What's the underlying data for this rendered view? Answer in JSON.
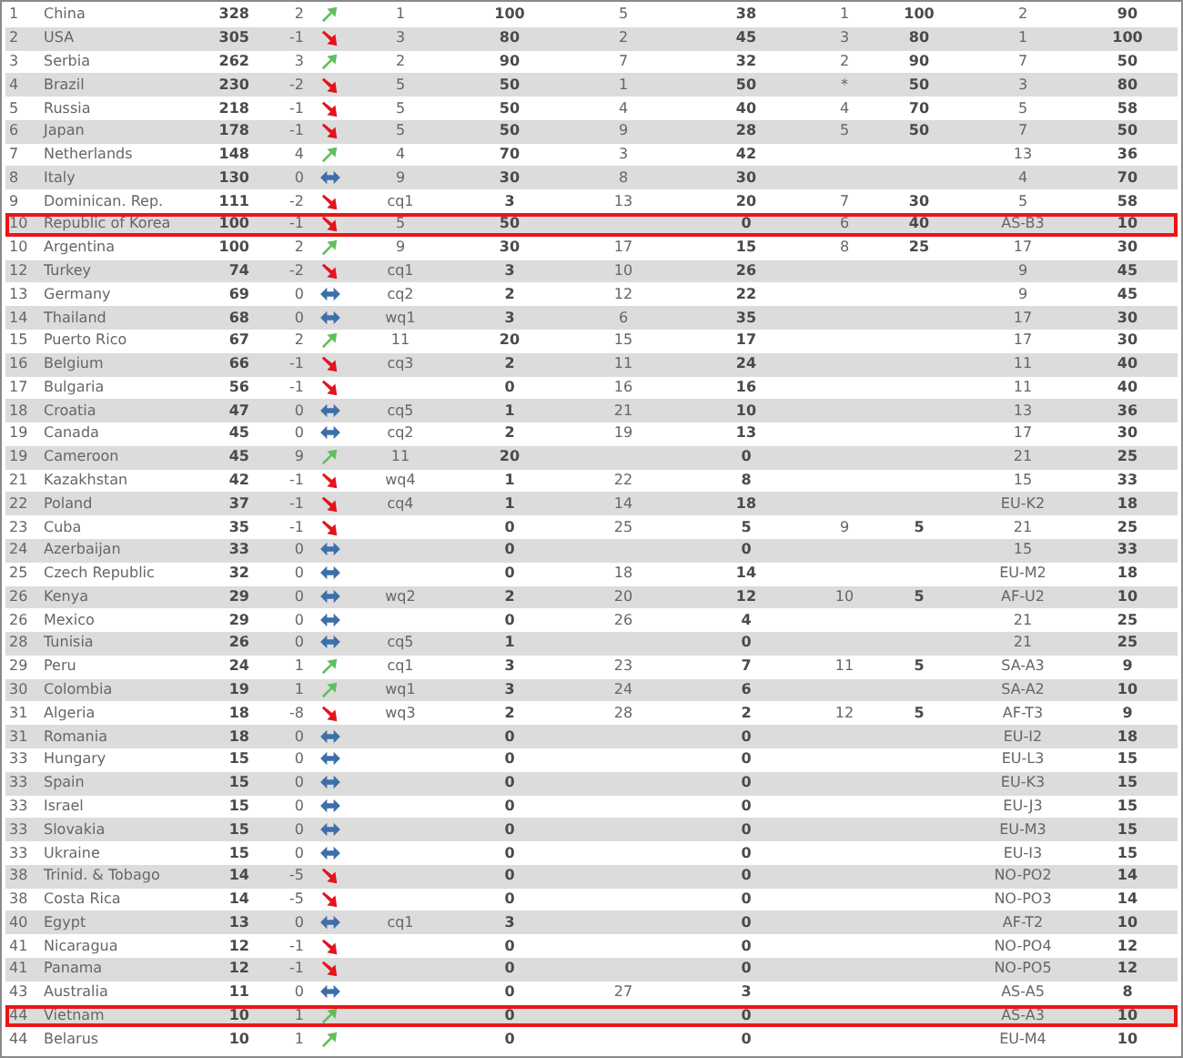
{
  "table": {
    "rows": [
      {
        "cells": [
          "1",
          "China",
          "328",
          "2",
          "1",
          "100",
          "5",
          "38",
          "1",
          "100",
          "2",
          "90"
        ],
        "trend": {
          "kind": "up"
        },
        "highlighted": false
      },
      {
        "cells": [
          "2",
          "USA",
          "305",
          "-1",
          "3",
          "80",
          "2",
          "45",
          "3",
          "80",
          "1",
          "100"
        ],
        "trend": {
          "kind": "down"
        },
        "highlighted": false
      },
      {
        "cells": [
          "3",
          "Serbia",
          "262",
          "3",
          "2",
          "90",
          "7",
          "32",
          "2",
          "90",
          "7",
          "50"
        ],
        "trend": {
          "kind": "up"
        },
        "highlighted": false
      },
      {
        "cells": [
          "4",
          "Brazil",
          "230",
          "-2",
          "5",
          "50",
          "1",
          "50",
          "*",
          "50",
          "3",
          "80"
        ],
        "trend": {
          "kind": "down"
        },
        "highlighted": false
      },
      {
        "cells": [
          "5",
          "Russia",
          "218",
          "-1",
          "5",
          "50",
          "4",
          "40",
          "4",
          "70",
          "5",
          "58"
        ],
        "trend": {
          "kind": "down"
        },
        "highlighted": false
      },
      {
        "cells": [
          "6",
          "Japan",
          "178",
          "-1",
          "5",
          "50",
          "9",
          "28",
          "5",
          "50",
          "7",
          "50"
        ],
        "trend": {
          "kind": "down"
        },
        "highlighted": false
      },
      {
        "cells": [
          "7",
          "Netherlands",
          "148",
          "4",
          "4",
          "70",
          "3",
          "42",
          null,
          null,
          "13",
          "36"
        ],
        "trend": {
          "kind": "up"
        },
        "highlighted": false
      },
      {
        "cells": [
          "8",
          "Italy",
          "130",
          "0",
          "9",
          "30",
          "8",
          "30",
          null,
          null,
          "4",
          "70"
        ],
        "trend": {
          "kind": "same"
        },
        "highlighted": false
      },
      {
        "cells": [
          "9",
          "Dominican. Rep.",
          "111",
          "-2",
          "cq1",
          "3",
          "13",
          "20",
          "7",
          "30",
          "5",
          "58"
        ],
        "trend": {
          "kind": "down"
        },
        "highlighted": false
      },
      {
        "cells": [
          "10",
          "Republic of Korea",
          "100",
          "-1",
          "5",
          "50",
          null,
          "0",
          "6",
          "40",
          "AS-B3",
          "10"
        ],
        "trend": {
          "kind": "down"
        },
        "highlighted": true
      },
      {
        "cells": [
          "10",
          "Argentina",
          "100",
          "2",
          "9",
          "30",
          "17",
          "15",
          "8",
          "25",
          "17",
          "30"
        ],
        "trend": {
          "kind": "up"
        },
        "highlighted": false
      },
      {
        "cells": [
          "12",
          "Turkey",
          "74",
          "-2",
          "cq1",
          "3",
          "10",
          "26",
          null,
          null,
          "9",
          "45"
        ],
        "trend": {
          "kind": "down"
        },
        "highlighted": false
      },
      {
        "cells": [
          "13",
          "Germany",
          "69",
          "0",
          "cq2",
          "2",
          "12",
          "22",
          null,
          null,
          "9",
          "45"
        ],
        "trend": {
          "kind": "same"
        },
        "highlighted": false
      },
      {
        "cells": [
          "14",
          "Thailand",
          "68",
          "0",
          "wq1",
          "3",
          "6",
          "35",
          null,
          null,
          "17",
          "30"
        ],
        "trend": {
          "kind": "same"
        },
        "highlighted": false
      },
      {
        "cells": [
          "15",
          "Puerto Rico",
          "67",
          "2",
          "11",
          "20",
          "15",
          "17",
          null,
          null,
          "17",
          "30"
        ],
        "trend": {
          "kind": "up"
        },
        "highlighted": false
      },
      {
        "cells": [
          "16",
          "Belgium",
          "66",
          "-1",
          "cq3",
          "2",
          "11",
          "24",
          null,
          null,
          "11",
          "40"
        ],
        "trend": {
          "kind": "down"
        },
        "highlighted": false
      },
      {
        "cells": [
          "17",
          "Bulgaria",
          "56",
          "-1",
          null,
          "0",
          "16",
          "16",
          null,
          null,
          "11",
          "40"
        ],
        "trend": {
          "kind": "down"
        },
        "highlighted": false
      },
      {
        "cells": [
          "18",
          "Croatia",
          "47",
          "0",
          "cq5",
          "1",
          "21",
          "10",
          null,
          null,
          "13",
          "36"
        ],
        "trend": {
          "kind": "same"
        },
        "highlighted": false
      },
      {
        "cells": [
          "19",
          "Canada",
          "45",
          "0",
          "cq2",
          "2",
          "19",
          "13",
          null,
          null,
          "17",
          "30"
        ],
        "trend": {
          "kind": "same"
        },
        "highlighted": false
      },
      {
        "cells": [
          "19",
          "Cameroon",
          "45",
          "9",
          "11",
          "20",
          null,
          "0",
          null,
          null,
          "21",
          "25"
        ],
        "trend": {
          "kind": "up"
        },
        "highlighted": false
      },
      {
        "cells": [
          "21",
          "Kazakhstan",
          "42",
          "-1",
          "wq4",
          "1",
          "22",
          "8",
          null,
          null,
          "15",
          "33"
        ],
        "trend": {
          "kind": "down"
        },
        "highlighted": false
      },
      {
        "cells": [
          "22",
          "Poland",
          "37",
          "-1",
          "cq4",
          "1",
          "14",
          "18",
          null,
          null,
          "EU-K2",
          "18"
        ],
        "trend": {
          "kind": "down"
        },
        "highlighted": false
      },
      {
        "cells": [
          "23",
          "Cuba",
          "35",
          "-1",
          null,
          "0",
          "25",
          "5",
          "9",
          "5",
          "21",
          "25"
        ],
        "trend": {
          "kind": "down"
        },
        "highlighted": false
      },
      {
        "cells": [
          "24",
          "Azerbaijan",
          "33",
          "0",
          null,
          "0",
          null,
          "0",
          null,
          null,
          "15",
          "33"
        ],
        "trend": {
          "kind": "same"
        },
        "highlighted": false
      },
      {
        "cells": [
          "25",
          "Czech Republic",
          "32",
          "0",
          null,
          "0",
          "18",
          "14",
          null,
          null,
          "EU-M2",
          "18"
        ],
        "trend": {
          "kind": "same"
        },
        "highlighted": false
      },
      {
        "cells": [
          "26",
          "Kenya",
          "29",
          "0",
          "wq2",
          "2",
          "20",
          "12",
          "10",
          "5",
          "AF-U2",
          "10"
        ],
        "trend": {
          "kind": "same"
        },
        "highlighted": false
      },
      {
        "cells": [
          "26",
          "Mexico",
          "29",
          "0",
          null,
          "0",
          "26",
          "4",
          null,
          null,
          "21",
          "25"
        ],
        "trend": {
          "kind": "same"
        },
        "highlighted": false
      },
      {
        "cells": [
          "28",
          "Tunisia",
          "26",
          "0",
          "cq5",
          "1",
          null,
          "0",
          null,
          null,
          "21",
          "25"
        ],
        "trend": {
          "kind": "same"
        },
        "highlighted": false
      },
      {
        "cells": [
          "29",
          "Peru",
          "24",
          "1",
          "cq1",
          "3",
          "23",
          "7",
          "11",
          "5",
          "SA-A3",
          "9"
        ],
        "trend": {
          "kind": "up"
        },
        "highlighted": false
      },
      {
        "cells": [
          "30",
          "Colombia",
          "19",
          "1",
          "wq1",
          "3",
          "24",
          "6",
          null,
          null,
          "SA-A2",
          "10"
        ],
        "trend": {
          "kind": "up"
        },
        "highlighted": false
      },
      {
        "cells": [
          "31",
          "Algeria",
          "18",
          "-8",
          "wq3",
          "2",
          "28",
          "2",
          "12",
          "5",
          "AF-T3",
          "9"
        ],
        "trend": {
          "kind": "down"
        },
        "highlighted": false
      },
      {
        "cells": [
          "31",
          "Romania",
          "18",
          "0",
          null,
          "0",
          null,
          "0",
          null,
          null,
          "EU-I2",
          "18"
        ],
        "trend": {
          "kind": "same"
        },
        "highlighted": false
      },
      {
        "cells": [
          "33",
          "Hungary",
          "15",
          "0",
          null,
          "0",
          null,
          "0",
          null,
          null,
          "EU-L3",
          "15"
        ],
        "trend": {
          "kind": "same"
        },
        "highlighted": false
      },
      {
        "cells": [
          "33",
          "Spain",
          "15",
          "0",
          null,
          "0",
          null,
          "0",
          null,
          null,
          "EU-K3",
          "15"
        ],
        "trend": {
          "kind": "same"
        },
        "highlighted": false
      },
      {
        "cells": [
          "33",
          "Israel",
          "15",
          "0",
          null,
          "0",
          null,
          "0",
          null,
          null,
          "EU-J3",
          "15"
        ],
        "trend": {
          "kind": "same"
        },
        "highlighted": false
      },
      {
        "cells": [
          "33",
          "Slovakia",
          "15",
          "0",
          null,
          "0",
          null,
          "0",
          null,
          null,
          "EU-M3",
          "15"
        ],
        "trend": {
          "kind": "same"
        },
        "highlighted": false
      },
      {
        "cells": [
          "33",
          "Ukraine",
          "15",
          "0",
          null,
          "0",
          null,
          "0",
          null,
          null,
          "EU-I3",
          "15"
        ],
        "trend": {
          "kind": "same"
        },
        "highlighted": false
      },
      {
        "cells": [
          "38",
          "Trinid. & Tobago",
          "14",
          "-5",
          null,
          "0",
          null,
          "0",
          null,
          null,
          "NO-PO2",
          "14"
        ],
        "trend": {
          "kind": "down"
        },
        "highlighted": false
      },
      {
        "cells": [
          "38",
          "Costa Rica",
          "14",
          "-5",
          null,
          "0",
          null,
          "0",
          null,
          null,
          "NO-PO3",
          "14"
        ],
        "trend": {
          "kind": "down"
        },
        "highlighted": false
      },
      {
        "cells": [
          "40",
          "Egypt",
          "13",
          "0",
          "cq1",
          "3",
          null,
          "0",
          null,
          null,
          "AF-T2",
          "10"
        ],
        "trend": {
          "kind": "same"
        },
        "highlighted": false
      },
      {
        "cells": [
          "41",
          "Nicaragua",
          "12",
          "-1",
          null,
          "0",
          null,
          "0",
          null,
          null,
          "NO-PO4",
          "12"
        ],
        "trend": {
          "kind": "down"
        },
        "highlighted": false
      },
      {
        "cells": [
          "41",
          "Panama",
          "12",
          "-1",
          null,
          "0",
          null,
          "0",
          null,
          null,
          "NO-PO5",
          "12"
        ],
        "trend": {
          "kind": "down"
        },
        "highlighted": false
      },
      {
        "cells": [
          "43",
          "Australia",
          "11",
          "0",
          null,
          "0",
          "27",
          "3",
          null,
          null,
          "AS-A5",
          "8"
        ],
        "trend": {
          "kind": "same"
        },
        "highlighted": false
      },
      {
        "cells": [
          "44",
          "Vietnam",
          "10",
          "1",
          null,
          "0",
          null,
          "0",
          null,
          null,
          "AS-A3",
          "10"
        ],
        "trend": {
          "kind": "up"
        },
        "highlighted": true
      },
      {
        "cells": [
          "44",
          "Belarus",
          "10",
          "1",
          null,
          "0",
          null,
          "0",
          null,
          null,
          "EU-M4",
          "10"
        ],
        "trend": {
          "kind": "up"
        },
        "highlighted": false
      }
    ]
  }
}
